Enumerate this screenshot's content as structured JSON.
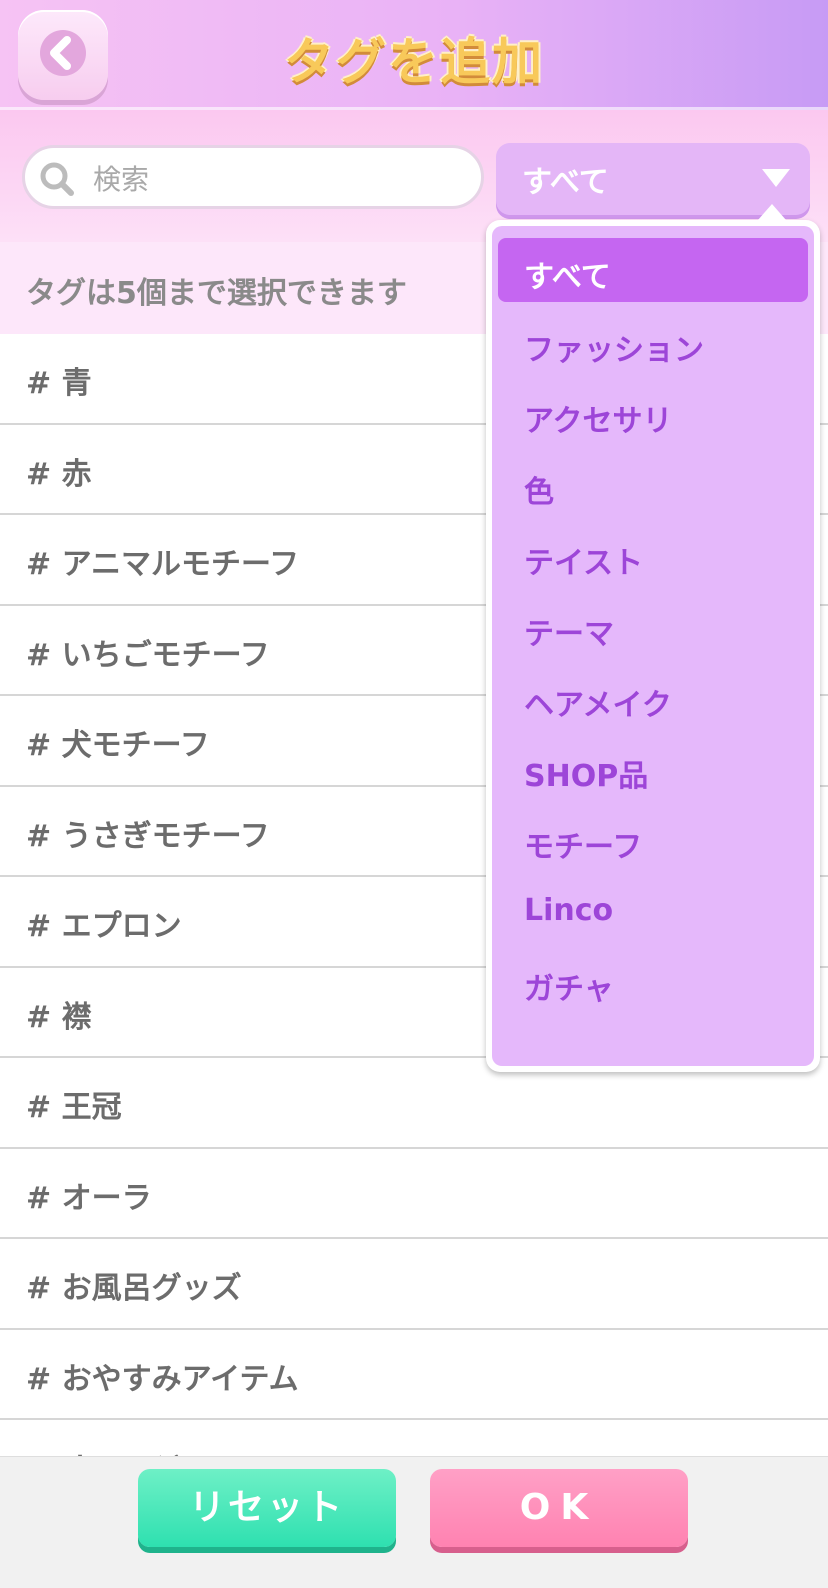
{
  "header": {
    "title": "タグを追加"
  },
  "search": {
    "placeholder": "検索",
    "value": ""
  },
  "category_select": {
    "selected": "すべて"
  },
  "info_text": "タグは5個まで選択できます",
  "tags": [
    "# 青",
    "# 赤",
    "# アニマルモチーフ",
    "# いちごモチーフ",
    "# 犬モチーフ",
    "# うさぎモチーフ",
    "# エプロン",
    "# 襟",
    "# 王冠",
    "# オーラ",
    "# お風呂グッズ",
    "# おやすみアイテム",
    "# オレンジ"
  ],
  "dropdown": {
    "options": [
      "すべて",
      "ファッション",
      "アクセサリ",
      "色",
      "テイスト",
      "テーマ",
      "ヘアメイク",
      "SHOP品",
      "モチーフ",
      "Linco",
      "ガチャ"
    ],
    "active_index": 0
  },
  "footer": {
    "reset_label": "リセット",
    "ok_label": "OK"
  },
  "colors": {
    "accent": "#c566f1",
    "reset": "#2ee0b0",
    "ok": "#ff82b1"
  },
  "icons": {
    "back": "chevron-left-icon",
    "search": "search-icon",
    "dropdown": "caret-down-icon"
  }
}
